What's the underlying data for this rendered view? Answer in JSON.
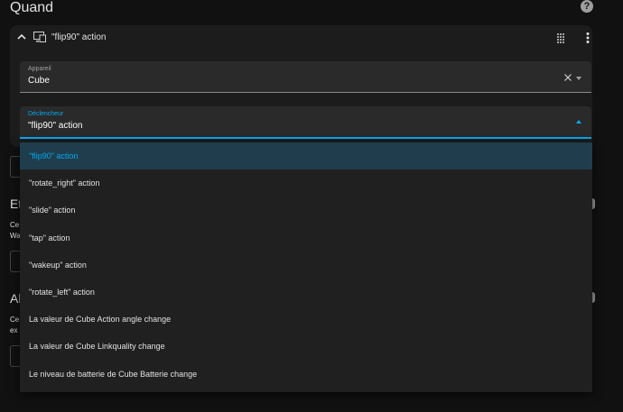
{
  "header": {
    "title": "Quand",
    "help_glyph": "?"
  },
  "trigger_card": {
    "title": "\"flip90\" action",
    "device_field": {
      "label": "Appareil",
      "value": "Cube"
    },
    "trigger_field": {
      "label": "Déclencheur",
      "value": "\"flip90\" action"
    }
  },
  "background_fragments": [
    "Et",
    "Ce",
    "Wa",
    "Al",
    "Ce",
    "ex"
  ],
  "dropdown": {
    "selected_index": 0,
    "options": [
      "\"flip90\" action",
      "\"rotate_right\" action",
      "\"slide\" action",
      "\"tap\" action",
      "\"wakeup\" action",
      "\"rotate_left\" action",
      "La valeur de Cube Action angle change",
      "La valeur de Cube Linkquality change",
      "Le niveau de batterie de Cube Batterie change"
    ]
  },
  "colors": {
    "accent": "#03a9f4",
    "selected_bg": "#1f3d4c",
    "surface": "#1c1c1c",
    "background": "#111111"
  },
  "icons": [
    "help-icon",
    "chevron-up-icon",
    "device-icon",
    "drag-handle-icon",
    "more-vert-icon",
    "clear-icon",
    "dropdown-arrow-icon"
  ]
}
